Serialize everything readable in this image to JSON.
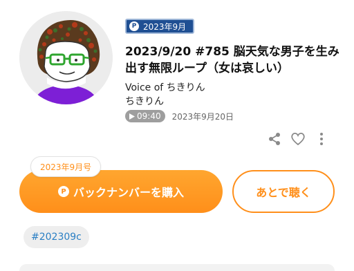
{
  "episode": {
    "badge": "2023年9月",
    "title": "2023/9/20 #785 脳天気な男子を生み出す無限ループ（女は哀しい）",
    "voice": "Voice of ちきりん",
    "author": "ちきりん",
    "duration": "09:40",
    "date": "2023年9月20日"
  },
  "icons": {
    "share": "share-icon",
    "like": "heart-icon",
    "more": "more-vertical-icon",
    "play": "play-icon",
    "premium": "premium-p-icon"
  },
  "purchase": {
    "tooltip": "2023年9月号",
    "buy_label": "バックナンバーを購入",
    "later_label": "あとで聴く"
  },
  "tag": "#202309c",
  "colors": {
    "accent": "#ff8f1a",
    "badge": "#1f4f93",
    "tag_text": "#2a7fc4"
  }
}
